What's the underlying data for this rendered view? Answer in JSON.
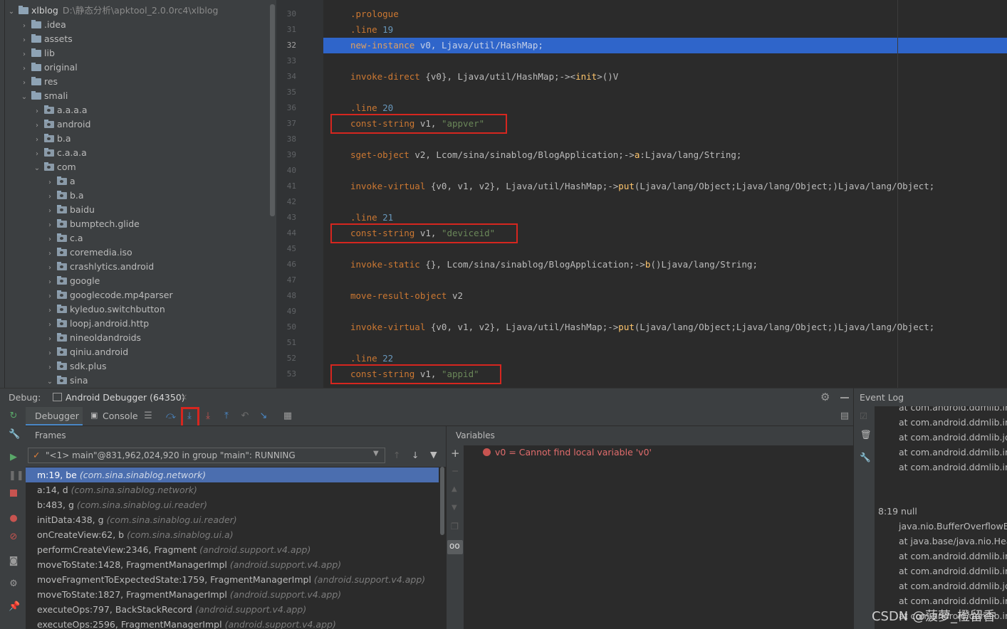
{
  "project_tree": {
    "root_label": "xlblog",
    "root_path": "D:\\静态分析\\apktool_2.0.0rc4\\xlblog",
    "items": [
      {
        "label": ".idea",
        "depth": 1,
        "expanded": false
      },
      {
        "label": "assets",
        "depth": 1,
        "expanded": false
      },
      {
        "label": "lib",
        "depth": 1,
        "expanded": false
      },
      {
        "label": "original",
        "depth": 1,
        "expanded": false
      },
      {
        "label": "res",
        "depth": 1,
        "expanded": false
      },
      {
        "label": "smali",
        "depth": 1,
        "expanded": true
      },
      {
        "label": "a.a.a.a",
        "depth": 2,
        "expanded": false
      },
      {
        "label": "android",
        "depth": 2,
        "expanded": false
      },
      {
        "label": "b.a",
        "depth": 2,
        "expanded": false
      },
      {
        "label": "c.a.a.a",
        "depth": 2,
        "expanded": false
      },
      {
        "label": "com",
        "depth": 2,
        "expanded": true
      },
      {
        "label": "a",
        "depth": 3,
        "expanded": false
      },
      {
        "label": "b.a",
        "depth": 3,
        "expanded": false
      },
      {
        "label": "baidu",
        "depth": 3,
        "expanded": false
      },
      {
        "label": "bumptech.glide",
        "depth": 3,
        "expanded": false
      },
      {
        "label": "c.a",
        "depth": 3,
        "expanded": false
      },
      {
        "label": "coremedia.iso",
        "depth": 3,
        "expanded": false
      },
      {
        "label": "crashlytics.android",
        "depth": 3,
        "expanded": false
      },
      {
        "label": "google",
        "depth": 3,
        "expanded": false
      },
      {
        "label": "googlecode.mp4parser",
        "depth": 3,
        "expanded": false
      },
      {
        "label": "kyleduo.switchbutton",
        "depth": 3,
        "expanded": false
      },
      {
        "label": "loopj.android.http",
        "depth": 3,
        "expanded": false
      },
      {
        "label": "nineoldandroids",
        "depth": 3,
        "expanded": false
      },
      {
        "label": "qiniu.android",
        "depth": 3,
        "expanded": false
      },
      {
        "label": "sdk.plus",
        "depth": 3,
        "expanded": false
      },
      {
        "label": "sina",
        "depth": 3,
        "expanded": true
      }
    ]
  },
  "editor": {
    "lines": [
      {
        "n": "30",
        "tokens": [
          {
            "t": ".prologue",
            "c": "dir"
          }
        ]
      },
      {
        "n": "31",
        "tokens": [
          {
            "t": ".line ",
            "c": "dir"
          },
          {
            "t": "19",
            "c": "num"
          }
        ]
      },
      {
        "n": "32",
        "tokens": [
          {
            "t": "new-instance",
            "c": "kw"
          },
          {
            "t": " v0, Ljava/util/HashMap;",
            "c": ""
          }
        ],
        "highlight": true
      },
      {
        "n": "33",
        "tokens": []
      },
      {
        "n": "34",
        "tokens": [
          {
            "t": "invoke-direct",
            "c": "kw"
          },
          {
            "t": " {v0}, Ljava/util/HashMap;-><",
            "c": ""
          },
          {
            "t": "init",
            "c": "met"
          },
          {
            "t": ">()V",
            "c": ""
          }
        ]
      },
      {
        "n": "35",
        "tokens": []
      },
      {
        "n": "36",
        "tokens": [
          {
            "t": ".line ",
            "c": "dir"
          },
          {
            "t": "20",
            "c": "num"
          }
        ]
      },
      {
        "n": "37",
        "tokens": [
          {
            "t": "const-string",
            "c": "kw"
          },
          {
            "t": " v1, ",
            "c": ""
          },
          {
            "t": "\"appver\"",
            "c": "str"
          }
        ],
        "boxed": true
      },
      {
        "n": "38",
        "tokens": []
      },
      {
        "n": "39",
        "tokens": [
          {
            "t": "sget-object",
            "c": "kw"
          },
          {
            "t": " v2, Lcom/sina/sinablog/BlogApplication;->",
            "c": ""
          },
          {
            "t": "a",
            "c": "met"
          },
          {
            "t": ":Ljava/lang/String;",
            "c": ""
          }
        ]
      },
      {
        "n": "40",
        "tokens": []
      },
      {
        "n": "41",
        "tokens": [
          {
            "t": "invoke-virtual",
            "c": "kw"
          },
          {
            "t": " {v0, v1, v2}, Ljava/util/HashMap;->",
            "c": ""
          },
          {
            "t": "put",
            "c": "met"
          },
          {
            "t": "(Ljava/lang/Object;Ljava/lang/Object;)Ljava/lang/Object;",
            "c": ""
          }
        ]
      },
      {
        "n": "42",
        "tokens": []
      },
      {
        "n": "43",
        "tokens": [
          {
            "t": ".line ",
            "c": "dir"
          },
          {
            "t": "21",
            "c": "num"
          }
        ]
      },
      {
        "n": "44",
        "tokens": [
          {
            "t": "const-string",
            "c": "kw"
          },
          {
            "t": " v1, ",
            "c": ""
          },
          {
            "t": "\"deviceid\"",
            "c": "str"
          }
        ],
        "boxed": true
      },
      {
        "n": "45",
        "tokens": []
      },
      {
        "n": "46",
        "tokens": [
          {
            "t": "invoke-static",
            "c": "kw"
          },
          {
            "t": " {}, Lcom/sina/sinablog/BlogApplication;->",
            "c": ""
          },
          {
            "t": "b",
            "c": "met"
          },
          {
            "t": "()Ljava/lang/String;",
            "c": ""
          }
        ]
      },
      {
        "n": "47",
        "tokens": []
      },
      {
        "n": "48",
        "tokens": [
          {
            "t": "move-result-object",
            "c": "kw"
          },
          {
            "t": " v2",
            "c": ""
          }
        ]
      },
      {
        "n": "49",
        "tokens": []
      },
      {
        "n": "50",
        "tokens": [
          {
            "t": "invoke-virtual",
            "c": "kw"
          },
          {
            "t": " {v0, v1, v2}, Ljava/util/HashMap;->",
            "c": ""
          },
          {
            "t": "put",
            "c": "met"
          },
          {
            "t": "(Ljava/lang/Object;Ljava/lang/Object;)Ljava/lang/Object;",
            "c": ""
          }
        ]
      },
      {
        "n": "51",
        "tokens": []
      },
      {
        "n": "52",
        "tokens": [
          {
            "t": ".line ",
            "c": "dir"
          },
          {
            "t": "22",
            "c": "num"
          }
        ]
      },
      {
        "n": "53",
        "tokens": [
          {
            "t": "const-string",
            "c": "kw"
          },
          {
            "t": " v1, ",
            "c": ""
          },
          {
            "t": "\"appid\"",
            "c": "str"
          }
        ],
        "boxed": true
      }
    ]
  },
  "debug": {
    "label": "Debug:",
    "tab_label": "Android Debugger (64350)",
    "tabs": [
      "Debugger",
      "Console"
    ],
    "frames_label": "Frames",
    "variables_label": "Variables",
    "thread": "\"<1> main\"@831,962,024,920 in group \"main\": RUNNING",
    "frames": [
      {
        "method": "m:19, be",
        "pkg": "(com.sina.sinablog.network)",
        "selected": true
      },
      {
        "method": "a:14, d",
        "pkg": "(com.sina.sinablog.network)"
      },
      {
        "method": "b:483, g",
        "pkg": "(com.sina.sinablog.ui.reader)"
      },
      {
        "method": "initData:438, g",
        "pkg": "(com.sina.sinablog.ui.reader)"
      },
      {
        "method": "onCreateView:62, b",
        "pkg": "(com.sina.sinablog.ui.a)"
      },
      {
        "method": "performCreateView:2346, Fragment",
        "pkg": "(android.support.v4.app)"
      },
      {
        "method": "moveToState:1428, FragmentManagerImpl",
        "pkg": "(android.support.v4.app)"
      },
      {
        "method": "moveFragmentToExpectedState:1759, FragmentManagerImpl",
        "pkg": "(android.support.v4.app)"
      },
      {
        "method": "moveToState:1827, FragmentManagerImpl",
        "pkg": "(android.support.v4.app)"
      },
      {
        "method": "executeOps:797, BackStackRecord",
        "pkg": "(android.support.v4.app)"
      },
      {
        "method": "executeOps:2596, FragmentManagerImpl",
        "pkg": "(android.support.v4.app)"
      }
    ],
    "variable_error": "v0 = Cannot find local variable 'v0'"
  },
  "event_log": {
    "title": "Event Log",
    "lines": [
      "at com.android.ddmlib.inte",
      "at com.android.ddmlib.inte",
      "at com.android.ddmlib.jdw",
      "at com.android.ddmlib.inte",
      "at com.android.ddmlib.inte"
    ],
    "time_line": "8:19 null",
    "lines2": [
      "java.nio.BufferOverflowExc",
      "at java.base/java.nio.Heapl",
      "at com.android.ddmlib.inte",
      "at com.android.ddmlib.inte",
      "at com.android.ddmlib.jdw",
      "at com.android.ddmlib.inte",
      "at com.android.ddmlib.inte"
    ]
  },
  "watermark": "CSDN @菠萝_橙留香",
  "colors": {
    "highlight": "#2f65ca",
    "red_box": "#d6261f",
    "selected_frame": "#4b6eaf"
  }
}
